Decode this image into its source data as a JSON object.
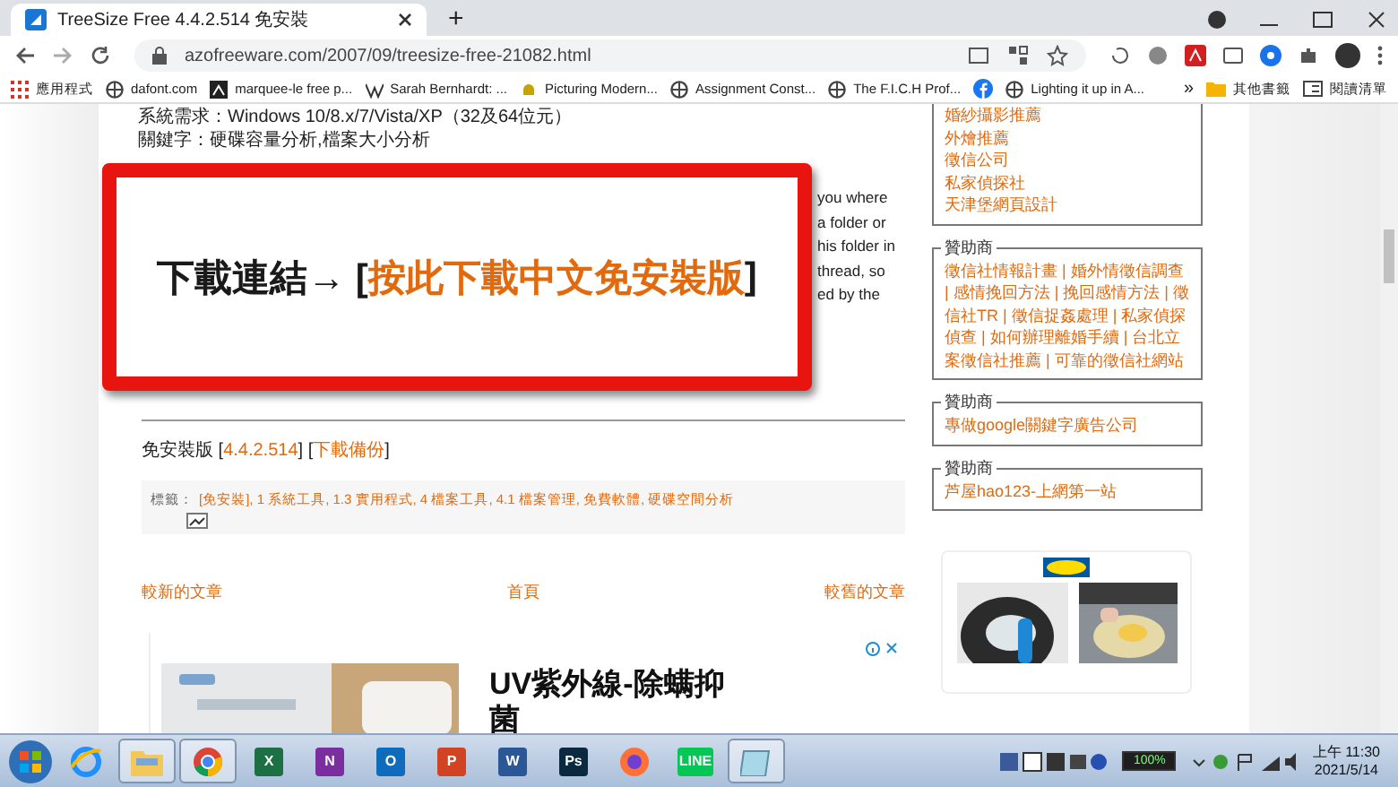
{
  "browser": {
    "tabs": [
      {
        "title": "TreeSize Free 4.4.2.514 免安裝",
        "selected": true
      }
    ],
    "new_tab": "+",
    "address": "azofreeware.com/2007/09/treesize-free-21082.html",
    "bookmarks": [
      {
        "kind": "apps",
        "label": "應用程式"
      },
      {
        "kind": "site",
        "label": "dafont.com"
      },
      {
        "kind": "dark",
        "label": "marquee-le free p..."
      },
      {
        "kind": "wiki",
        "label": "Sarah Bernhardt: ..."
      },
      {
        "kind": "note",
        "label": "Picturing Modern..."
      },
      {
        "kind": "site",
        "label": "Assignment Const..."
      },
      {
        "kind": "site",
        "label": "The F.I.C.H Prof..."
      },
      {
        "kind": "social"
      },
      {
        "kind": "site",
        "label": "Lighting it up in A..."
      }
    ],
    "more": "»",
    "folders": [
      {
        "kind": "folder",
        "label": "其他書籤"
      },
      {
        "kind": "list",
        "label": "閱讀清單"
      }
    ]
  },
  "article": {
    "meta": [
      "系統需求：Windows 10/8.x/7/Vista/XP（32及64位元）",
      "關鍵字：硬碟容量分析,檔案大小分析"
    ],
    "banner": {
      "label": "下載連結→ [",
      "link": "按此下載中文免安裝版",
      "end": "]"
    },
    "behind_banner": [
      "you where",
      "a folder or",
      "his folder in",
      "thread, so",
      "ed by the"
    ],
    "version": {
      "label": "免安裝版",
      "open": "[",
      "version": "4.4.2.514",
      "middle": "] [",
      "backup": "下載備份",
      "close": "]"
    },
    "tags": {
      "label": "標籤：",
      "items": "[免安裝], 1 系統工具, 1.3 實用程式, 4 檔案工具, 4.1 檔案管理, 免費軟體, 硬碟空間分析"
    },
    "nav": [
      "較新的文章",
      "首頁",
      "較舊的文章"
    ],
    "ad": {
      "headline": "UV紫外線-除螨抑",
      "headline_2": "菌"
    }
  },
  "sidebar": {
    "boxes": [
      {
        "lines": [
          "婚紗攝影推薦",
          "外燴推薦",
          "徵信公司",
          "私家偵探社",
          "天津堡網頁設計"
        ]
      },
      {
        "legend": "贊助商",
        "lines": [
          "徵信社情報計畫 | 婚外情徵信調查 | 感情挽回方法 | 挽回感情方法 | 徵信社TR | 徵信捉姦處理 | 私家偵探偵查 | 如何辦理離婚手續 | 台北立案徵信社推薦 | 可靠的徵信社網站"
        ]
      },
      {
        "legend": "贊助商",
        "lines": [
          "專做google關鍵字廣告公司"
        ]
      },
      {
        "legend": "贊助商",
        "lines": [
          "芦屋hao123-上網第一站"
        ]
      }
    ]
  },
  "taskbar": {
    "apps": [
      {
        "kind": "ie",
        "selected": false
      },
      {
        "kind": "explorer",
        "selected": true
      },
      {
        "kind": "chrome",
        "selected": true
      },
      {
        "kind": "tile",
        "glyph": "X",
        "color": "#1d7044",
        "selected": false
      },
      {
        "kind": "tile",
        "glyph": "N",
        "color": "#7b2f9e",
        "selected": false
      },
      {
        "kind": "tile",
        "glyph": "O",
        "color": "#0f6cbd",
        "selected": false
      },
      {
        "kind": "tile",
        "glyph": "P",
        "color": "#d04423",
        "selected": false
      },
      {
        "kind": "tile",
        "glyph": "W",
        "color": "#2b5797",
        "selected": false
      },
      {
        "kind": "tile",
        "glyph": "Ps",
        "color": "#0b2a3f",
        "selected": false
      },
      {
        "kind": "firefox",
        "selected": false
      },
      {
        "kind": "tile",
        "glyph": "LINE",
        "color": "#06c755",
        "selected": false
      },
      {
        "kind": "notes",
        "selected": true
      }
    ],
    "battery": "100%",
    "time": "上午 11:30",
    "date": "2021/5/14"
  }
}
